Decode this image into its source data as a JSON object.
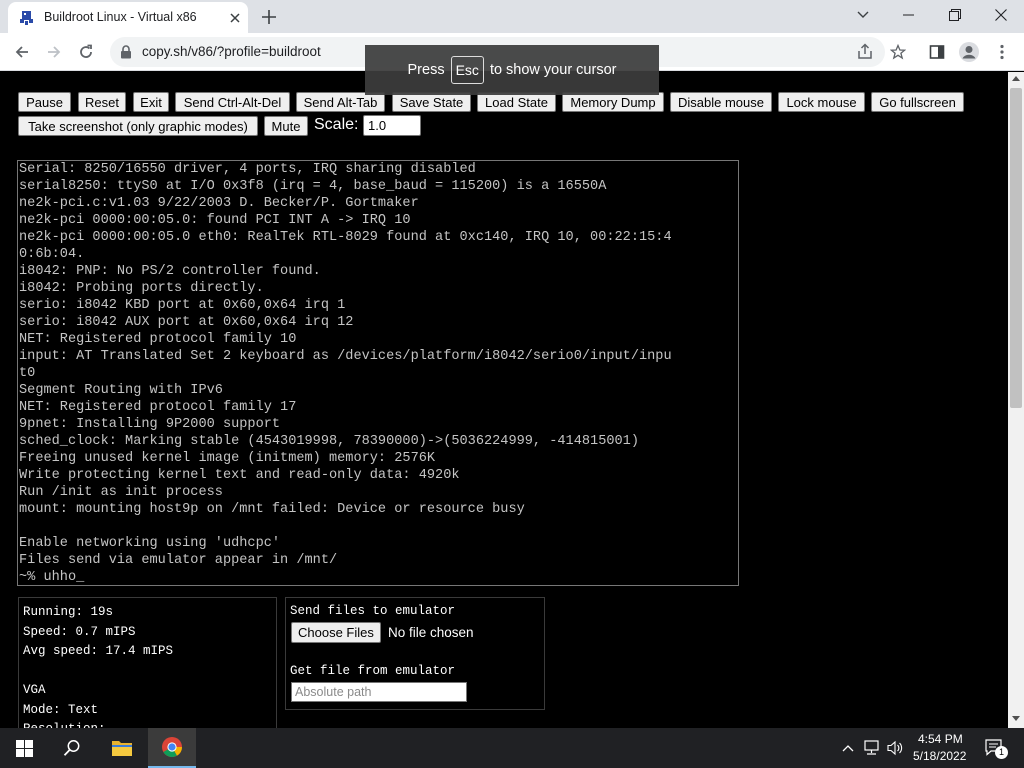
{
  "browser": {
    "tab_title": "Buildroot Linux - Virtual x86",
    "url": "copy.sh/v86/?profile=buildroot"
  },
  "cursor_hint": {
    "press": "Press",
    "key": "Esc",
    "rest": "to show your cursor"
  },
  "controls": {
    "buttons": [
      "Pause",
      "Reset",
      "Exit",
      "Send Ctrl-Alt-Del",
      "Send Alt-Tab",
      "Save State",
      "Load State",
      "Memory Dump",
      "Disable mouse",
      "Lock mouse",
      "Go fullscreen",
      "Take screenshot (only graphic modes)",
      "Mute"
    ],
    "scale_label": "Scale:",
    "scale_value": "1.0"
  },
  "terminal": {
    "lines": [
      "Serial: 8250/16550 driver, 4 ports, IRQ sharing disabled",
      "serial8250: ttyS0 at I/O 0x3f8 (irq = 4, base_baud = 115200) is a 16550A",
      "ne2k-pci.c:v1.03 9/22/2003 D. Becker/P. Gortmaker",
      "ne2k-pci 0000:00:05.0: found PCI INT A -> IRQ 10",
      "ne2k-pci 0000:00:05.0 eth0: RealTek RTL-8029 found at 0xc140, IRQ 10, 00:22:15:4",
      "0:6b:04.",
      "i8042: PNP: No PS/2 controller found.",
      "i8042: Probing ports directly.",
      "serio: i8042 KBD port at 0x60,0x64 irq 1",
      "serio: i8042 AUX port at 0x60,0x64 irq 12",
      "NET: Registered protocol family 10",
      "input: AT Translated Set 2 keyboard as /devices/platform/i8042/serio0/input/inpu",
      "t0",
      "Segment Routing with IPv6",
      "NET: Registered protocol family 17",
      "9pnet: Installing 9P2000 support",
      "sched_clock: Marking stable (4543019998, 78390000)->(5036224999, -414815001)",
      "Freeing unused kernel image (initmem) memory: 2576K",
      "Write protecting kernel text and read-only data: 4920k",
      "Run /init as init process",
      "mount: mounting host9p on /mnt failed: Device or resource busy",
      "",
      "Enable networking using 'udhcpc'",
      "Files send via emulator appear in /mnt/",
      "~% uhho_"
    ]
  },
  "stats": {
    "lines": [
      "Running: 19s",
      "Speed: 0.7 mIPS",
      "Avg speed: 17.4 mIPS",
      "",
      "VGA",
      "Mode: Text",
      "Resolution: -"
    ]
  },
  "files": {
    "send_heading": "Send files to emulator",
    "choose_label": "Choose Files",
    "no_file": "No file chosen",
    "get_heading": "Get file from emulator",
    "path_placeholder": "Absolute path"
  },
  "taskbar": {
    "time": "4:54 PM",
    "date": "5/18/2022",
    "notification_count": "1"
  }
}
